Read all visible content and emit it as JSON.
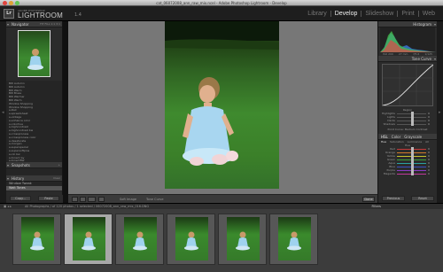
{
  "window": {
    "title": "cat_06072008_ann_raw_mix.ncel - Adobe Photoshop Lightroom - Develop"
  },
  "app": {
    "logo_letters": "Lr",
    "logo_sub": "ADOBE PHOTOSHOP",
    "logo_name": "LIGHTROOM",
    "version": "1.4"
  },
  "modules": [
    "Library",
    "Develop",
    "Slideshow",
    "Print",
    "Web"
  ],
  "active_module": "Develop",
  "left_panel": {
    "navigator": {
      "title": "Navigator",
      "zoom_opts": "FIT  FILL  1:1  3:1"
    },
    "presets": [
      "BW Autumn",
      "BW Autumn",
      "BW Warm",
      "BW Blues",
      "BW Warmer",
      "BW Warm",
      "Window Shopping",
      "Window Shopping",
      "e-Rail",
      "e-spreadsheet",
      "e-vintage",
      "e-enhance color",
      "e-colorhue",
      "e-highcontrast",
      "e-highcontrast bw",
      "e-crossprocess",
      "e-crossprocess color",
      "e-desaturate",
      "e-morgan",
      "e-superspecial",
      "e-supersoftplus",
      "e-cin bw",
      "e-toned ray",
      "e-toned BW"
    ],
    "snapshots": {
      "title": "Snapshots"
    },
    "history": {
      "title": "History",
      "clear_label": "Clear",
      "items": [
        "Window Tweak",
        "Wait Tones"
      ]
    },
    "copy_label": "Copy...",
    "paste_label": "Paste"
  },
  "toolbar": {
    "soft_proof": "Soft Image",
    "tone_curve": "Tone Curve",
    "done_label": "Done"
  },
  "right_panel": {
    "histogram_title": "Histogram",
    "histogram_info": [
      "ISO 200",
      "27 mm",
      "f/5.6",
      "1/125"
    ],
    "tone_curve_title": "Tone Curve",
    "region_label": "Region",
    "tone_sliders": [
      {
        "label": "Highlights",
        "value": "0",
        "pos": 0.5
      },
      {
        "label": "Lights",
        "value": "0",
        "pos": 0.5
      },
      {
        "label": "Darks",
        "value": "0",
        "pos": 0.5
      },
      {
        "label": "Shadows",
        "value": "0",
        "pos": 0.5
      }
    ],
    "point_curve_label": "Point Curve: Medium Contrast",
    "hsl_tabs": [
      "HSL",
      "Color",
      "Grayscale"
    ],
    "hsl_subtabs": [
      "Hue",
      "Saturation",
      "Luminance",
      "All"
    ],
    "hue_label": "Hue",
    "hsl_sliders": [
      {
        "label": "Red",
        "value": "0",
        "color": "#c23a3a"
      },
      {
        "label": "Orange",
        "value": "0",
        "color": "#d07a2a"
      },
      {
        "label": "Yellow",
        "value": "0",
        "color": "#c8c02a"
      },
      {
        "label": "Green",
        "value": "0",
        "color": "#3aa03a"
      },
      {
        "label": "Aqua",
        "value": "0",
        "color": "#2aa0a0"
      },
      {
        "label": "Blue",
        "value": "0",
        "color": "#3a4ec2"
      },
      {
        "label": "Purple",
        "value": "0",
        "color": "#8a3ac2"
      },
      {
        "label": "Magenta",
        "value": "0",
        "color": "#c23a9a"
      }
    ],
    "previous_label": "Previous",
    "reset_label": "Reset"
  },
  "filmstrip": {
    "status": "All Photographs  /  of 120 photos / 1 selected /  06072008_ann_raw_mix_016.DNG",
    "filters_label": "Filters",
    "selected_index": 1,
    "count": 6
  }
}
